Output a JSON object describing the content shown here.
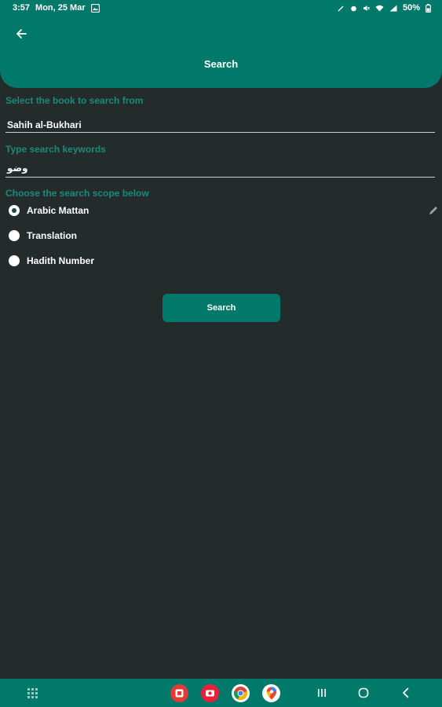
{
  "status_bar": {
    "time": "3:57",
    "date": "Mon, 25 Mar",
    "battery": "50%"
  },
  "header": {
    "title": "Search"
  },
  "form": {
    "book_label": "Select the book to search from",
    "book_value": "Sahih al-Bukhari",
    "keyword_label": "Type search keywords",
    "keyword_value": "وضو",
    "scope_label": "Choose the search scope below",
    "scope_options": [
      {
        "label": "Arabic Mattan",
        "selected": true
      },
      {
        "label": "Translation",
        "selected": false
      },
      {
        "label": "Hadith Number",
        "selected": false
      }
    ]
  },
  "actions": {
    "search_label": "Search"
  },
  "colors": {
    "primary": "#00786a",
    "background": "#242b2b",
    "label": "#1b8a7d"
  },
  "icons": {
    "back": "arrow-left-icon",
    "edit": "pencil-icon",
    "apps": "grid-icon",
    "recents": "recents-icon",
    "home": "home-icon",
    "nav_back": "chevron-left-icon"
  }
}
